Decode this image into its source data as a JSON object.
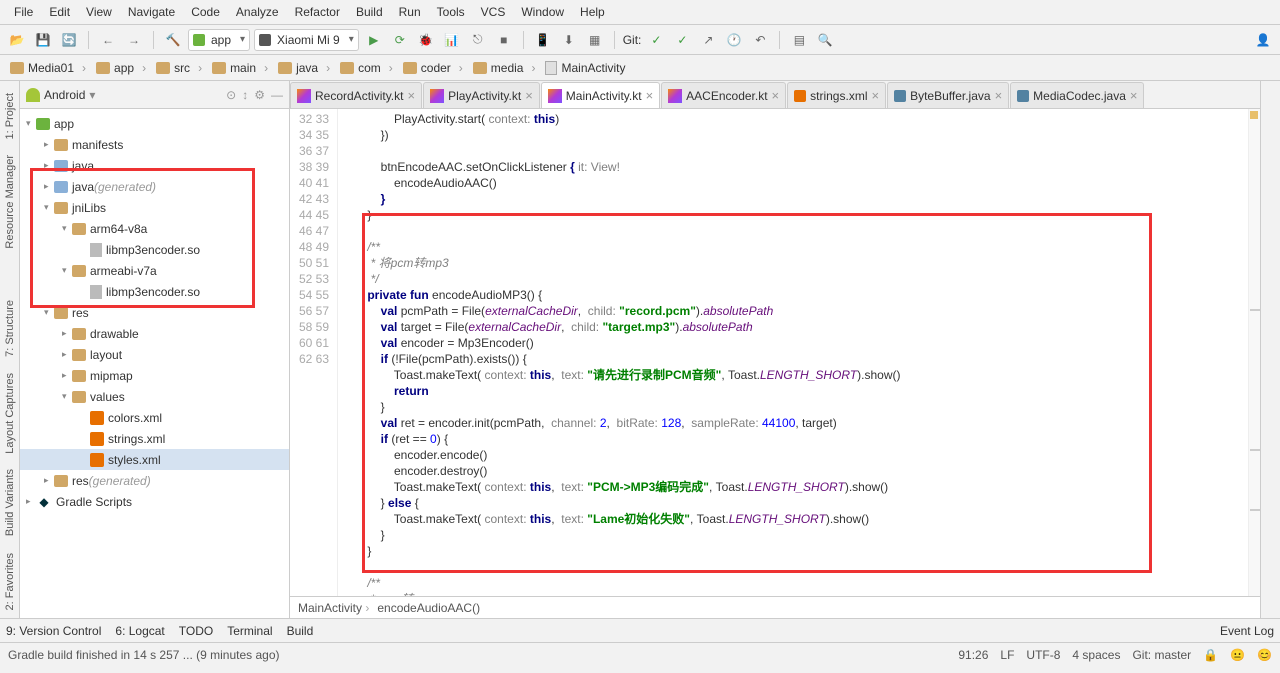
{
  "menu": [
    "File",
    "Edit",
    "View",
    "Navigate",
    "Code",
    "Analyze",
    "Refactor",
    "Build",
    "Run",
    "Tools",
    "VCS",
    "Window",
    "Help"
  ],
  "toolbar": {
    "config": "app",
    "device": "Xiaomi Mi 9",
    "git": "Git:"
  },
  "breadcrumbs": [
    "Media01",
    "app",
    "src",
    "main",
    "java",
    "com",
    "coder",
    "media",
    "MainActivity"
  ],
  "sidebar": {
    "mode": "Android",
    "tree": [
      {
        "d": 0,
        "tw": "▾",
        "ico": "grn",
        "label": "app"
      },
      {
        "d": 1,
        "tw": "▸",
        "ico": "fldr",
        "label": "manifests"
      },
      {
        "d": 1,
        "tw": "▸",
        "ico": "blue",
        "label": "java"
      },
      {
        "d": 1,
        "tw": "▸",
        "ico": "blue",
        "label": "java",
        "gen": " (generated)"
      },
      {
        "d": 1,
        "tw": "▾",
        "ico": "fldr",
        "label": "jniLibs"
      },
      {
        "d": 2,
        "tw": "▾",
        "ico": "fldr",
        "label": "arm64-v8a"
      },
      {
        "d": 3,
        "tw": "",
        "ico": "file",
        "label": "libmp3encoder.so"
      },
      {
        "d": 2,
        "tw": "▾",
        "ico": "fldr",
        "label": "armeabi-v7a"
      },
      {
        "d": 3,
        "tw": "",
        "ico": "file",
        "label": "libmp3encoder.so"
      },
      {
        "d": 1,
        "tw": "▾",
        "ico": "fldr",
        "label": "res"
      },
      {
        "d": 2,
        "tw": "▸",
        "ico": "fldr",
        "label": "drawable"
      },
      {
        "d": 2,
        "tw": "▸",
        "ico": "fldr",
        "label": "layout"
      },
      {
        "d": 2,
        "tw": "▸",
        "ico": "fldr",
        "label": "mipmap"
      },
      {
        "d": 2,
        "tw": "▾",
        "ico": "fldr",
        "label": "values"
      },
      {
        "d": 3,
        "tw": "",
        "ico": "xml",
        "label": "colors.xml"
      },
      {
        "d": 3,
        "tw": "",
        "ico": "xml",
        "label": "strings.xml"
      },
      {
        "d": 3,
        "tw": "",
        "ico": "xml",
        "label": "styles.xml",
        "sel": true
      },
      {
        "d": 1,
        "tw": "▸",
        "ico": "fldr",
        "label": "res",
        "gen": " (generated)"
      },
      {
        "d": 0,
        "tw": "▸",
        "ico": "gradle",
        "label": "Gradle Scripts"
      }
    ]
  },
  "tabs": [
    {
      "ico": "kt",
      "label": "RecordActivity.kt"
    },
    {
      "ico": "kt",
      "label": "PlayActivity.kt"
    },
    {
      "ico": "kt",
      "label": "MainActivity.kt",
      "active": true
    },
    {
      "ico": "kt",
      "label": "AACEncoder.kt"
    },
    {
      "ico": "xml",
      "label": "strings.xml"
    },
    {
      "ico": "java",
      "label": "ByteBuffer.java"
    },
    {
      "ico": "java",
      "label": "MediaCodec.java"
    }
  ],
  "gutter": {
    "start": 32,
    "end": 63
  },
  "code": [
    "            PlayActivity.start( <ann>context:</ann> <kw>this</kw>)",
    "        })",
    "",
    "        btnEncodeAAC.setOnClickListener <kw>{</kw> <ann>it: View!</ann>",
    "            encodeAudioAAC()",
    "        <kw>}</kw>",
    "    }",
    "",
    "    <com>/**</com>",
    "    <com> * 将pcm转mp3</com>",
    "    <com> */</com>",
    "    <kw>private fun</kw> encodeAudioMP3() {",
    "        <kw>val</kw> pcmPath = File(<fld>externalCacheDir</fld>,  <ann>child:</ann> <str>\"record.pcm\"</str>).<fld>absolutePath</fld>",
    "        <kw>val</kw> target = File(<fld>externalCacheDir</fld>,  <ann>child:</ann> <str>\"target.mp3\"</str>).<fld>absolutePath</fld>",
    "        <kw>val</kw> encoder = Mp3Encoder()",
    "        <kw>if</kw> (!File(pcmPath).exists()) {",
    "            Toast.makeText( <ann>context:</ann> <kw>this</kw>,  <ann>text:</ann> <str>\"请先进行录制PCM音频\"</str>, Toast.<fld>LENGTH_SHORT</fld>).show()",
    "            <kw>return</kw>",
    "        }",
    "        <kw>val</kw> ret = encoder.init(pcmPath,  <ann>channel:</ann> <num>2</num>,  <ann>bitRate:</ann> <num>128</num>,  <ann>sampleRate:</ann> <num>44100</num>, target)",
    "        <kw>if</kw> (ret == <num>0</num>) {",
    "            encoder.encode()",
    "            encoder.destroy()",
    "            Toast.makeText( <ann>context:</ann> <kw>this</kw>,  <ann>text:</ann> <str>\"PCM-&gt;MP3编码完成\"</str>, Toast.<fld>LENGTH_SHORT</fld>).show()",
    "        } <kw>else</kw> {",
    "            Toast.makeText( <ann>context:</ann> <kw>this</kw>,  <ann>text:</ann> <str>\"Lame初始化失败\"</str>, Toast.<fld>LENGTH_SHORT</fld>).show()",
    "        }",
    "    }",
    "",
    "    <com>/**</com>",
    "    <com> * pcm转aac</com>",
    "    <com> */</com>"
  ],
  "crumbs2": [
    "MainActivity",
    "encodeAudioAAC()"
  ],
  "bottom": [
    "9: Version Control",
    "6: Logcat",
    "TODO",
    "Terminal",
    "Build"
  ],
  "bottom_right": "Event Log",
  "status": {
    "msg": "Gradle build finished in 14 s 257 ... (9 minutes ago)",
    "pos": "91:26",
    "le": "LF",
    "enc": "UTF-8",
    "indent": "4 spaces",
    "git": "Git: master"
  }
}
